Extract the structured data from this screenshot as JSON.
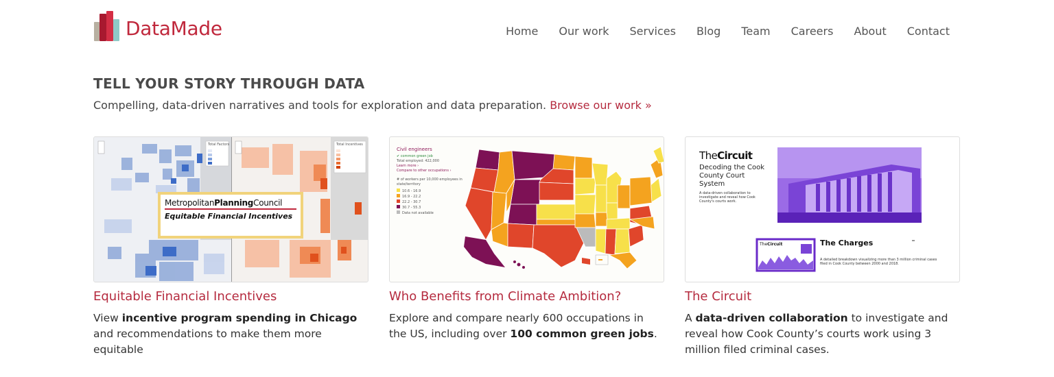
{
  "header": {
    "logo_text": "DataMade",
    "nav": [
      "Home",
      "Our work",
      "Services",
      "Blog",
      "Team",
      "Careers",
      "About",
      "Contact"
    ]
  },
  "hero": {
    "title": "TELL YOUR STORY THROUGH DATA",
    "subtitle": "Compelling, data-driven narratives and tools for exploration and data preparation.",
    "browse_link": "Browse our work »"
  },
  "cards": [
    {
      "title": "Equitable Financial Incentives",
      "desc_pre": "View ",
      "desc_bold": "incentive program spending in Chicago",
      "desc_post": " and recommendations to make them more equitable",
      "thumb": {
        "badge_name_a": "Metropolitan",
        "badge_name_b": "Planning",
        "badge_name_c": "Council",
        "badge_sub": "Equitable Financial Incentives",
        "legend_left_title": "Total Factors",
        "legend_right_title": "Total Incentives"
      }
    },
    {
      "title": "Who Benefits from Climate Ambition?",
      "desc_pre": "Explore and compare nearly 600 occupations in the US, including over ",
      "desc_bold": "100 common green jobs",
      "desc_post": ".",
      "thumb": {
        "occupation": "Civil engineers",
        "green_label": "✔ common green job",
        "employed": "Total employed: 422,000",
        "learn_more": "Learn more ›",
        "compare": "Compare to other occupations ›",
        "legend_title": "# of workers per 10,000 employees in state/territory",
        "legend_items": [
          "10.6 - 16.9",
          "16.9 - 22.2",
          "22.2 - 30.7",
          "30.7 - 55.3",
          "Data not available"
        ],
        "legend_colors": [
          "#f7e04a",
          "#f4a31f",
          "#e0462b",
          "#7d1155",
          "#bbbbbb"
        ]
      }
    },
    {
      "title": "The Circuit",
      "desc_pre": "A ",
      "desc_bold": "data-driven collaboration",
      "desc_post": " to investigate and reveal how Cook County’s courts work using 3 million filed criminal cases.",
      "thumb": {
        "brand_a": "The",
        "brand_b": "Circuit",
        "heading": "Decoding the Cook County Court System",
        "blurb": "A data-driven collaboration to investigate and reveal how Cook County's courts work.",
        "charges_title": "The Charges",
        "charges_blurb": "A detailed breakdown visualizing more than 3 million criminal cases filed in Cook County between 2000 and 2018."
      }
    }
  ]
}
